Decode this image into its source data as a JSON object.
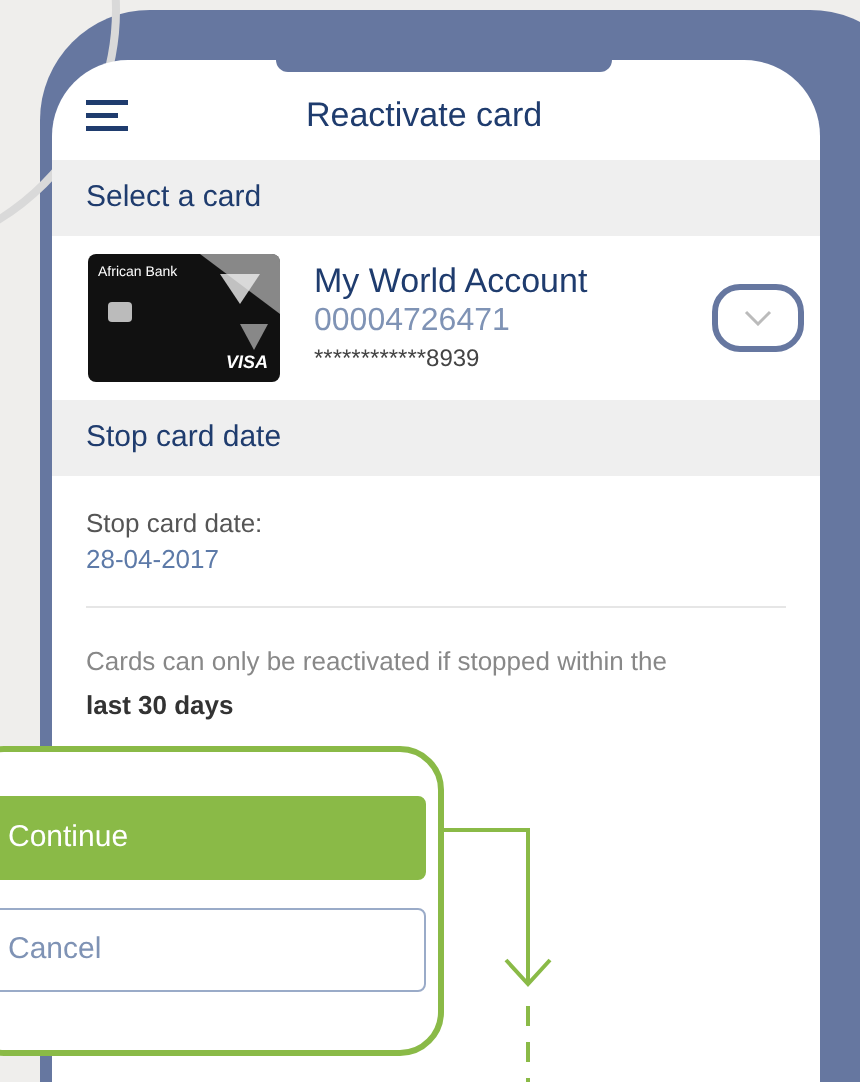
{
  "header": {
    "title": "Reactivate card"
  },
  "select_section": {
    "title": "Select a card"
  },
  "card": {
    "brand": "African Bank",
    "network": "VISA",
    "name": "My World Account",
    "account_number": "00004726471",
    "masked_number": "************8939"
  },
  "stop_section": {
    "title": "Stop card date"
  },
  "stop_date": {
    "label": "Stop card date:",
    "value": "28-04-2017"
  },
  "note": "Cards can only be reactivated if stopped within the **last 30 days**",
  "buttons": [
    {
      "kind": "primary",
      "label": "Continue"
    },
    {
      "kind": "secondary",
      "label": "Cancel"
    }
  ]
}
